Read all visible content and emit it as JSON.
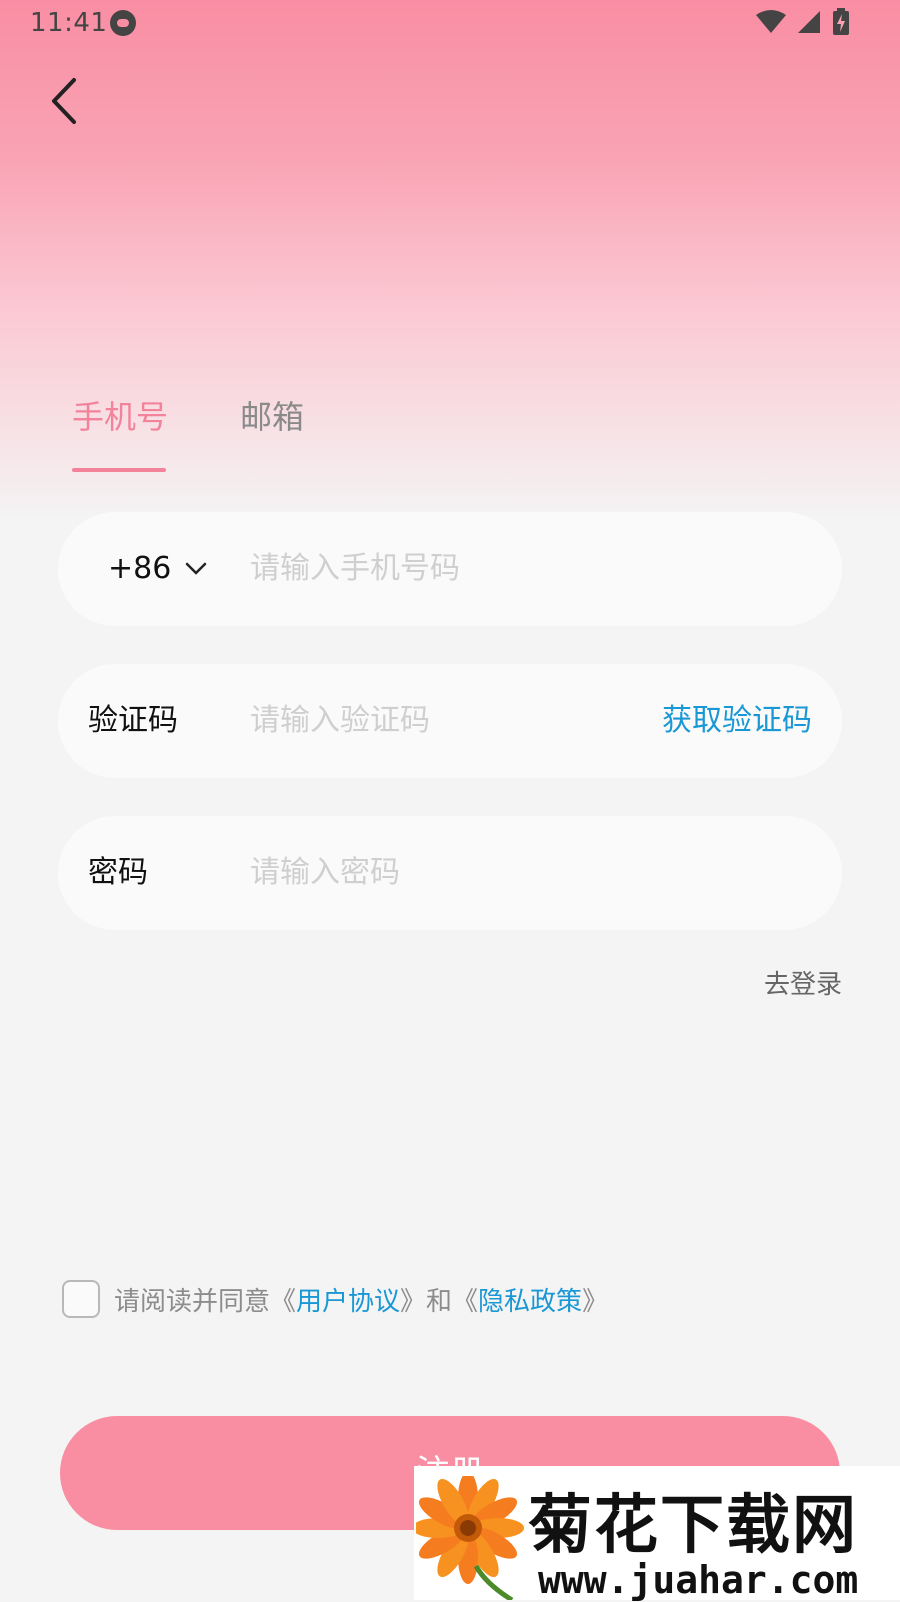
{
  "status_bar": {
    "time": "11:41"
  },
  "tabs": [
    {
      "label": "手机号",
      "active": true
    },
    {
      "label": "邮箱",
      "active": false
    }
  ],
  "phone_field": {
    "country_code": "+86",
    "placeholder": "请输入手机号码"
  },
  "code_field": {
    "label": "验证码",
    "placeholder": "请输入验证码",
    "get_code": "获取验证码"
  },
  "password_field": {
    "label": "密码",
    "placeholder": "请输入密码"
  },
  "to_login": "去登录",
  "agreement": {
    "prefix": "请阅读并同意《",
    "user_agreement": "用户协议",
    "middle": "》和《",
    "privacy_policy": "隐私政策",
    "suffix": "》"
  },
  "register_button": "注册",
  "watermark": {
    "title": "菊花下载网",
    "url": "www.juahar.com"
  },
  "colors": {
    "accent": "#f98ea3",
    "link": "#1a98d5"
  }
}
